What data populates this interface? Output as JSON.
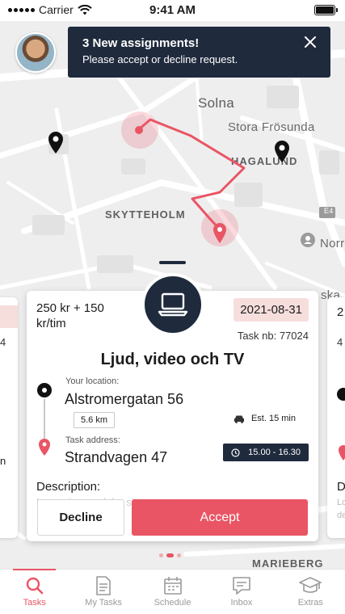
{
  "status_bar": {
    "carrier": "Carrier",
    "time": "9:41 AM"
  },
  "map": {
    "labels": {
      "solna": "Solna",
      "stora_frosunda": "Stora Frösunda",
      "hagalund": "HAGALUND",
      "skytteholm": "SKYTTEHOLM",
      "norra": "Norra",
      "ska": "ska",
      "marieberg": "MARIEBERG",
      "e4": "E4"
    },
    "route_color": "#e95564"
  },
  "notification": {
    "title": "3 New assignments!",
    "text": "Please accept or decline request.",
    "close_icon": "close-icon"
  },
  "task": {
    "price": "250 kr + 150 kr/tim",
    "date": "2021-08-31",
    "task_number": "Task nb: 77024",
    "title": "Ljud, video och TV",
    "your_location_label": "Your location:",
    "your_location": "Alstromergatan 56",
    "distance": "5.6 km",
    "estimate": "Est. 15 min",
    "task_address_label": "Task address:",
    "task_address": "Strandvagen 47",
    "time_window": "15.00 - 16.30",
    "description_label": "Description:",
    "description_preview": "Lorem ipsum dolor sit amet",
    "decline_label": "Decline",
    "accept_label": "Accept",
    "category_icon": "laptop-icon"
  },
  "side_cards": {
    "right_date_fragment": "2",
    "right_number_fragment": "4",
    "right_desc_fragment": "D",
    "right_lo": "Lo",
    "right_de": "de",
    "left_number_fragment": "4",
    "left_n": "n"
  },
  "tabs": [
    {
      "label": "Tasks",
      "icon": "search-icon",
      "active": true
    },
    {
      "label": "My Tasks",
      "icon": "document-icon",
      "active": false
    },
    {
      "label": "Schedule",
      "icon": "calendar-icon",
      "active": false
    },
    {
      "label": "Inbox",
      "icon": "chat-icon",
      "active": false
    },
    {
      "label": "Extras",
      "icon": "graduation-cap-icon",
      "active": false
    }
  ],
  "colors": {
    "accent": "#e95564",
    "navy": "#1f2a3d",
    "date_badge": "#f6dedd"
  }
}
